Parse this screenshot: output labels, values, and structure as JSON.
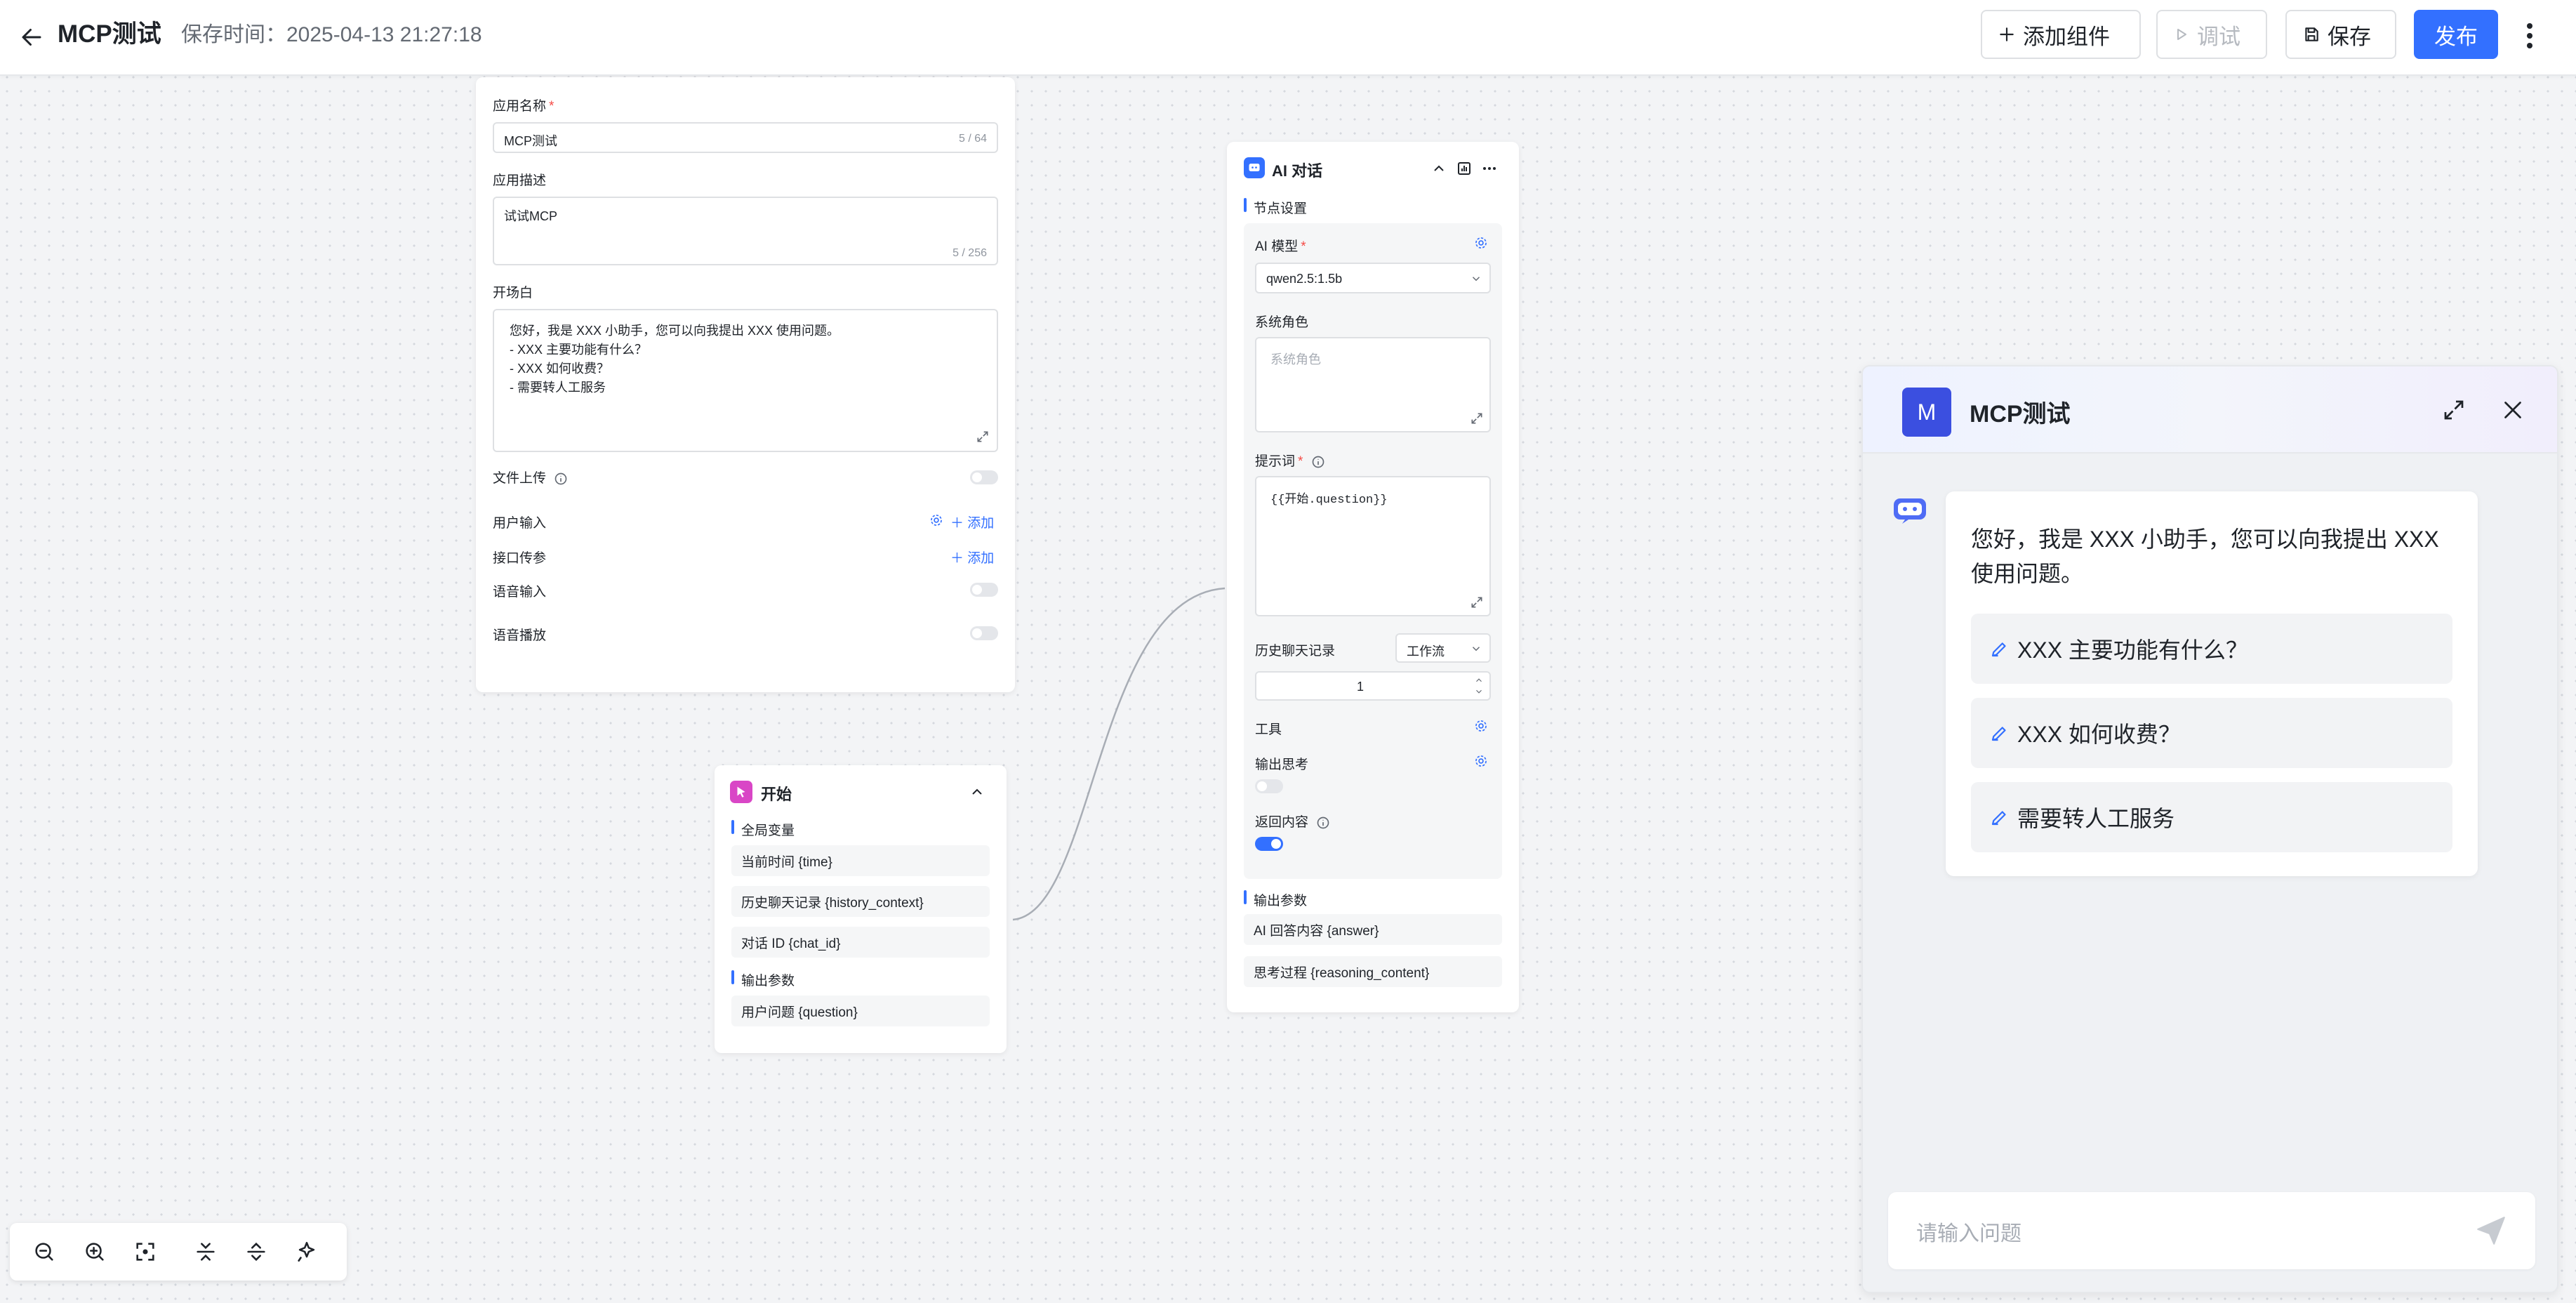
{
  "header": {
    "title": "MCP测试",
    "save_time": "保存时间：2025-04-13 21:27:18",
    "add_component": "添加组件",
    "debug": "调试",
    "save": "保存",
    "publish": "发布",
    "accent_color": "#3370ff"
  },
  "app_settings": {
    "name_label": "应用名称",
    "name_value": "MCP测试",
    "name_count": "5 / 64",
    "desc_label": "应用描述",
    "desc_value": "试试MCP",
    "desc_count": "5 / 256",
    "opening_label": "开场白",
    "opening_lines": [
      "您好，我是 XXX 小助手，您可以向我提出 XXX 使用问题。",
      "- XXX 主要功能有什么？",
      "- XXX 如何收费？",
      "- 需要转人工服务"
    ],
    "file_upload": "文件上传",
    "user_input": "用户输入",
    "api_params": "接口传参",
    "add": "添加",
    "voice_input": "语音输入",
    "voice_playback": "语音播放"
  },
  "start_node": {
    "title": "开始",
    "global_vars": "全局变量",
    "vars": [
      "当前时间 {time}",
      "历史聊天记录 {history_context}",
      "对话 ID {chat_id}"
    ],
    "output_params": "输出参数",
    "outputs": [
      "用户问题 {question}"
    ]
  },
  "ai_node": {
    "title": "AI 对话",
    "node_settings": "节点设置",
    "model_label": "AI 模型",
    "model_value": "qwen2.5:1.5b",
    "system_role_label": "系统角色",
    "system_role_placeholder": "系统角色",
    "prompt_label": "提示词",
    "prompt_value": "{{开始.question}}",
    "history_label": "历史聊天记录",
    "history_type": "工作流",
    "history_count": "1",
    "tools_label": "工具",
    "output_thinking_label": "输出思考",
    "return_content_label": "返回内容",
    "output_params": "输出参数",
    "outputs": [
      "AI 回答内容 {answer}",
      "思考过程 {reasoning_content}"
    ]
  },
  "chat": {
    "avatar_letter": "M",
    "title": "MCP测试",
    "greeting": "您好，我是 XXX 小助手，您可以向我提出 XXX 使用问题。",
    "suggestions": [
      "XXX 主要功能有什么？",
      "XXX 如何收费？",
      "需要转人工服务"
    ],
    "input_placeholder": "请输入问题",
    "avatar_color": "#3b4fe0"
  }
}
